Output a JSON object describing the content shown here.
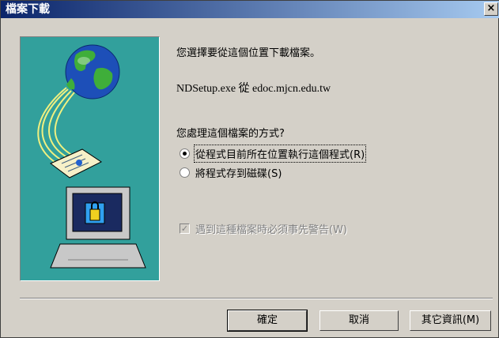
{
  "window": {
    "title": "檔案下載",
    "close_label": "×"
  },
  "main": {
    "prompt": "您選擇要從這個位置下載檔案。",
    "file_source": "NDSetup.exe 從 edoc.mjcn.edu.tw",
    "question": "您處理這個檔案的方式?",
    "options": [
      {
        "label": "從程式目前所在位置執行這個程式(R)",
        "selected": true
      },
      {
        "label": "將程式存到磁碟(S)",
        "selected": false
      }
    ],
    "warn_checkbox": {
      "label": "遇到這種檔案時必須事先警告(W)",
      "checked": true,
      "disabled": true
    }
  },
  "buttons": {
    "ok": "確定",
    "cancel": "取消",
    "more_info": "其它資訊(M)"
  }
}
